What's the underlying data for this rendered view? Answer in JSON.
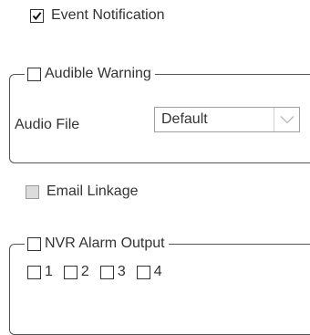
{
  "event_notification": {
    "label": "Event Notification",
    "checked": true
  },
  "audible_warning": {
    "label": "Audible Warning",
    "checked": false,
    "audio_file_label": "Audio File",
    "audio_file_value": "Default"
  },
  "email_linkage": {
    "label": "Email Linkage",
    "checked": false,
    "disabled": true
  },
  "nvr_alarm_output": {
    "label": "NVR Alarm Output",
    "checked": false,
    "outputs": [
      {
        "label": "1",
        "checked": false
      },
      {
        "label": "2",
        "checked": false
      },
      {
        "label": "3",
        "checked": false
      },
      {
        "label": "4",
        "checked": false
      }
    ]
  },
  "colors": {
    "text": "#333333",
    "border": "#555555",
    "disabled_fill": "#dcdcdc",
    "select_arrow": "#b8b8b8"
  },
  "icons": {
    "checked_mark": "checkmark-icon",
    "dropdown_arrow": "chevron-down-icon"
  }
}
